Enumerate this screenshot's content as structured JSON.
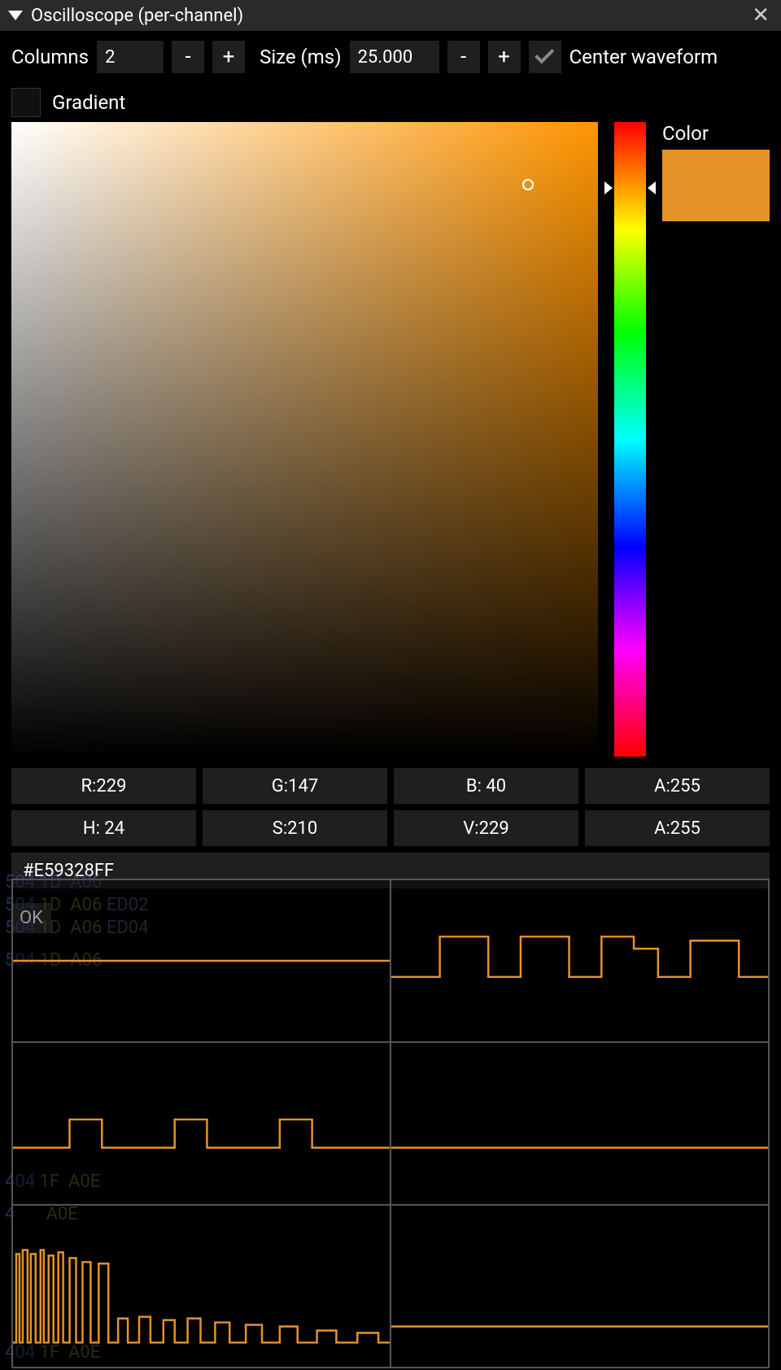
{
  "titlebar": {
    "title": "Oscilloscope (per-channel)"
  },
  "toolbar": {
    "columns_label": "Columns",
    "columns_value": "2",
    "minus": "-",
    "plus": "+",
    "size_label": "Size (ms)",
    "size_value": "25.000",
    "center_label": "Center waveform"
  },
  "gradient_label": "Gradient",
  "color_label": "Color",
  "rgba": {
    "r": "R:229",
    "g": "G:147",
    "b": "B: 40",
    "a": "A:255"
  },
  "hsva": {
    "h": "H: 24",
    "s": "S:210",
    "v": "V:229",
    "a": "A:255"
  },
  "hex": "#E59328FF",
  "ok": "OK",
  "selected_color": "#E59328",
  "bg_tracker": {
    "l1": "504 1D  A06",
    "l2": "504 1D  A06 ED02",
    "l3": "504 1D  A06 ED04",
    "l4": "504 1D  A06",
    "l5": "404 1F  A0E",
    "l6": "4       A0E",
    "l7": "404 1F  A0E"
  }
}
